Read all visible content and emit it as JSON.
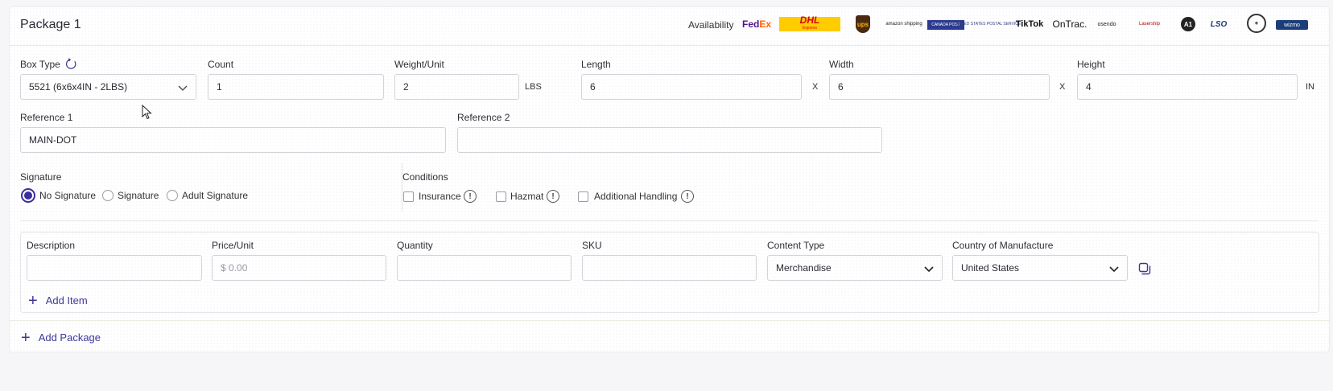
{
  "package": {
    "title": "Package 1",
    "availability_label": "Availability",
    "carriers": {
      "fedex_a": "Fed",
      "fedex_b": "Ex",
      "dhl": "DHL",
      "dhl_sub": "Express",
      "ups": "ups",
      "amazon": "amazon shipping",
      "canada_post": "CANADA POST",
      "usps": "UNITED STATES POSTAL SERVICE",
      "tiktok": "TikTok",
      "ontrac": "OnTrac.",
      "osendo": "osendo",
      "lasership": "Lasership",
      "a1": "A1",
      "lso": "LSO",
      "wizmo": "wizmo"
    }
  },
  "box": {
    "box_type_label": "Box Type",
    "box_type_value": "5521 (6x6x4IN - 2LBS)",
    "count_label": "Count",
    "count_value": "1",
    "weight_label": "Weight/Unit",
    "weight_value": "2",
    "weight_unit": "LBS",
    "length_label": "Length",
    "length_value": "6",
    "width_label": "Width",
    "width_value": "6",
    "height_label": "Height",
    "height_value": "4",
    "dim_sep": "X",
    "dim_unit": "IN"
  },
  "references": {
    "ref1_label": "Reference 1",
    "ref1_value": "MAIN-DOT",
    "ref2_label": "Reference 2",
    "ref2_value": ""
  },
  "signature": {
    "label": "Signature",
    "options": [
      "No Signature",
      "Signature",
      "Adult Signature"
    ],
    "selected": "No Signature"
  },
  "conditions": {
    "label": "Conditions",
    "options": [
      "Insurance",
      "Hazmat",
      "Additional Handling"
    ]
  },
  "items": {
    "description_label": "Description",
    "price_label": "Price/Unit",
    "price_placeholder": "$  0.00",
    "quantity_label": "Quantity",
    "sku_label": "SKU",
    "content_type_label": "Content Type",
    "content_type_value": "Merchandise",
    "country_label": "Country of Manufacture",
    "country_value": "United States",
    "add_item": "Add Item"
  },
  "add_package": "Add Package",
  "colors": {
    "accent": "#3a2f9c",
    "border": "#d3d3da",
    "background": "#f6f6f9"
  }
}
